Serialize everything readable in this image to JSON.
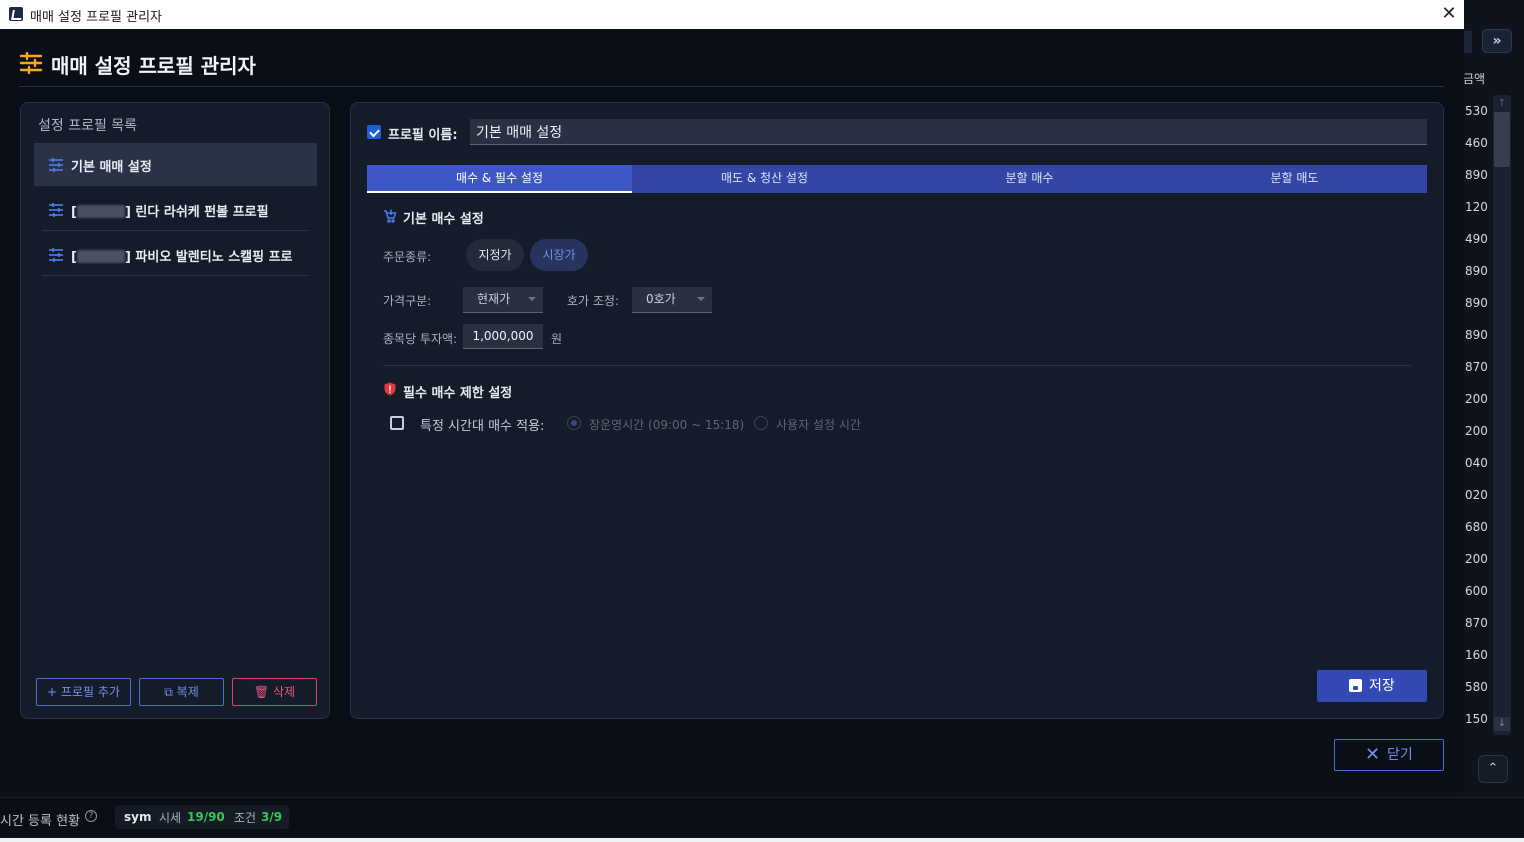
{
  "window": {
    "title": "매매 설정 프로필 관리자",
    "close_glyph": "✕"
  },
  "header": {
    "title": "매매 설정 프로필 관리자",
    "accent_color": "#f5a623"
  },
  "profile_list": {
    "title": "설정 프로필 목록",
    "items": [
      {
        "label": "기본 매매 설정",
        "active": true
      },
      {
        "label_prefix": "[",
        "label_suffix": "] 린다 라쉬케 펀볼 프로필",
        "redacted": true
      },
      {
        "label_prefix": "[",
        "label_suffix": "] 파비오 발렌티노 스캘핑 프로",
        "redacted": true
      }
    ],
    "buttons": {
      "add": "+ 프로필 추가",
      "copy": "⧉ 복제",
      "delete": "🗑 삭제"
    }
  },
  "editor": {
    "profile_name_label": "프로필 이름:",
    "profile_name_value": "기본 매매 설정",
    "tabs": [
      "매수 & 필수 설정",
      "매도 & 청산 설정",
      "분할 매수",
      "분할 매도"
    ],
    "active_tab": 0,
    "basic_buy": {
      "title": "기본 매수 설정",
      "order_type_label": "주문종류:",
      "order_types": [
        "지정가",
        "시장가"
      ],
      "selected_order_type": "시장가",
      "price_type_label": "가격구분:",
      "price_type_value": "현재가",
      "tick_adjust_label": "호가 조정:",
      "tick_adjust_value": "0호가",
      "amount_label": "종목당 투자액:",
      "amount_value": "1,000,000",
      "amount_unit": "원"
    },
    "buy_limit": {
      "title": "필수 매수 제한 설정",
      "time_check_label": "특정 시간대 매수 적용:",
      "time_check_checked": false,
      "radio_market_hours": "장운영시간 (09:00 ~ 15:18)",
      "radio_custom": "사용자 설정 시간"
    },
    "save_label": "저장",
    "close_label": "닫기"
  },
  "background": {
    "column_header": "금액",
    "values": [
      "530",
      "460",
      "890",
      "120",
      "490",
      "890",
      "890",
      "890",
      "870",
      "200",
      "200",
      "040",
      "020",
      "680",
      "200",
      "600",
      "870",
      "160",
      "580",
      "150"
    ],
    "expand_glyph": "»",
    "scroll_up_glyph": "⌃",
    "status": {
      "label": "시간 등록 현황",
      "help": "?",
      "sym": "sym",
      "quote_label": "시세",
      "quote_value": "19/90",
      "cond_label": "조건",
      "cond_value": "3/9"
    }
  }
}
